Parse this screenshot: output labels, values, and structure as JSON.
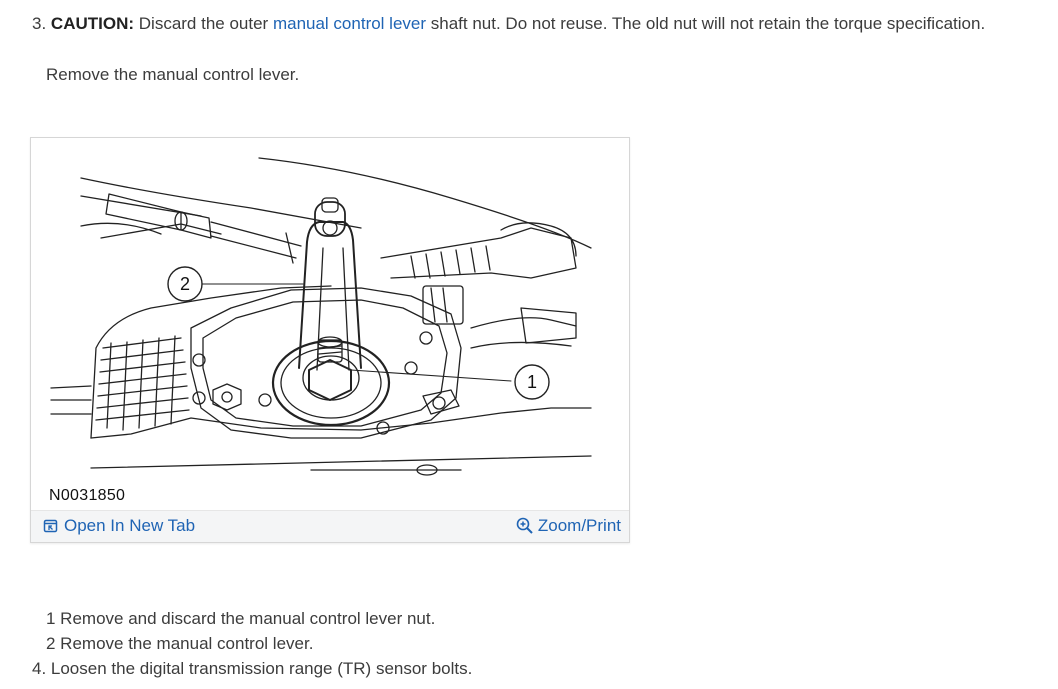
{
  "step3": {
    "number": "3.",
    "caution_label": "CAUTION:",
    "text_before_link": "Discard the outer",
    "link_text": "manual control lever",
    "text_after_link": "shaft nut. Do not reuse. The old nut will not retain the torque specification.",
    "instruction": "Remove the manual control lever."
  },
  "figure": {
    "callouts": [
      "2",
      "1"
    ],
    "figure_id": "N0031850",
    "open_tab_label": "Open In New Tab",
    "zoom_label": "Zoom/Print",
    "link_color": "#1f64b4"
  },
  "legend": [
    "1  Remove and discard the manual control lever nut.",
    "2  Remove the manual control lever."
  ],
  "step4": "4. Loosen the digital transmission range (TR) sensor bolts."
}
